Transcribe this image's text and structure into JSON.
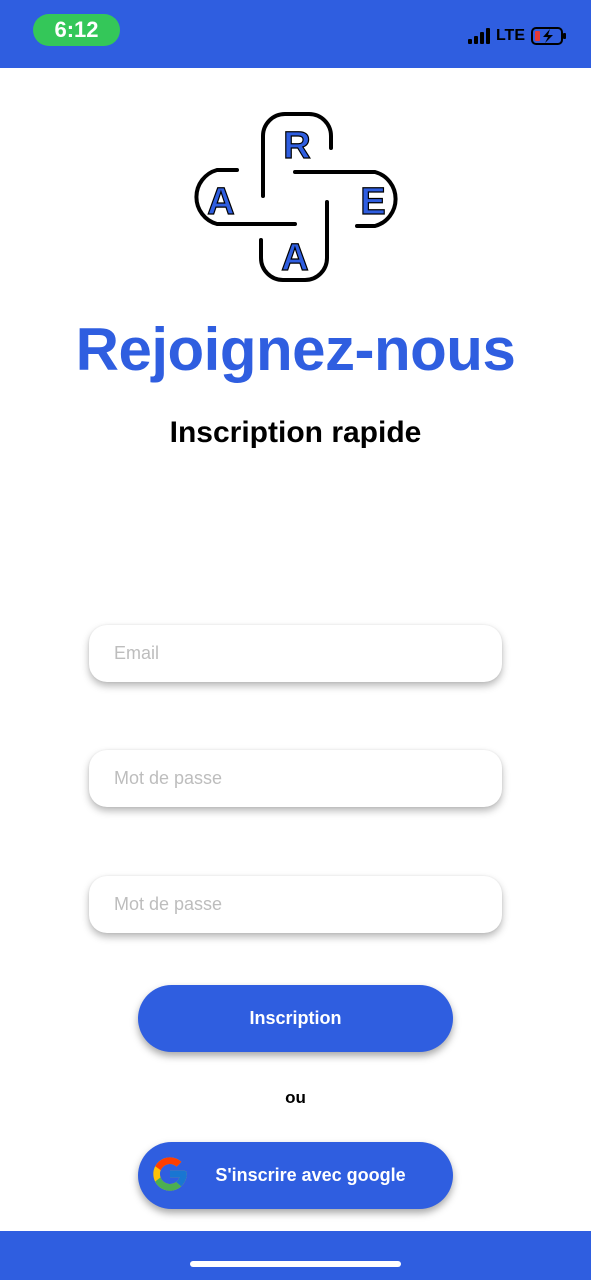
{
  "status_bar": {
    "time": "6:12",
    "network": "LTE",
    "icons": [
      "signal-icon",
      "battery-charging-icon"
    ]
  },
  "logo": {
    "letters": {
      "top": "R",
      "left": "A",
      "right": "E",
      "bottom": "A"
    }
  },
  "header": {
    "title": "Rejoignez-nous",
    "subtitle": "Inscription rapide"
  },
  "form": {
    "email": {
      "placeholder": "Email",
      "value": ""
    },
    "password": {
      "placeholder": "Mot de passe",
      "value": ""
    },
    "password_confirm": {
      "placeholder": "Mot de passe",
      "value": ""
    },
    "submit_label": "Inscription"
  },
  "separator": "ou",
  "google_button": {
    "label": "S'inscrire avec google",
    "icon": "google-icon"
  },
  "colors": {
    "brand": "#2f5ee0",
    "status_pill": "#34c759",
    "background": "#ffffff",
    "placeholder": "#bdbdbd"
  }
}
